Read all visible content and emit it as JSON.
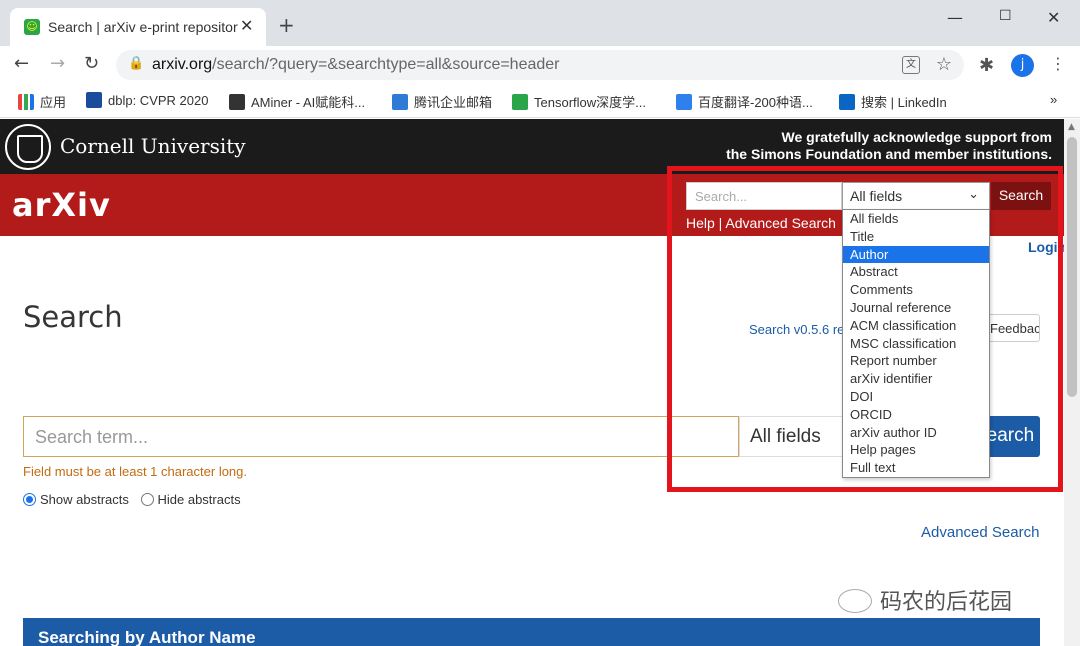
{
  "browser": {
    "tab_title": "Search | arXiv e-print repository",
    "tab_close": "✕",
    "new_tab": "+",
    "url_host": "arxiv.org",
    "url_rest": "/search/?query=&searchtype=all&source=header",
    "profile_initial": "j",
    "bookmarks": [
      {
        "label": "应用",
        "icon_color": "#e8453c"
      },
      {
        "label": "dblp: CVPR 2020",
        "icon_color": "#1b4c9c"
      },
      {
        "label": "AMiner - AI赋能科...",
        "icon_color": "#333333"
      },
      {
        "label": "腾讯企业邮箱",
        "icon_color": "#2d7bd6"
      },
      {
        "label": "Tensorflow深度学...",
        "icon_color": "#2aa54a"
      },
      {
        "label": "百度翻译-200种语...",
        "icon_color": "#2f80ed"
      },
      {
        "label": "搜索 | LinkedIn",
        "icon_color": "#0a66c2"
      }
    ],
    "bookmarks_more": "»"
  },
  "header": {
    "institution": "Cornell University",
    "support_line1": "We gratefully acknowledge support from",
    "support_line2": "the Simons Foundation and member institutions.",
    "logo": "arXiv",
    "search_placeholder": "Search...",
    "field_selected": "All fields",
    "search_button": "Search",
    "help_links": "Help | Advanced Search",
    "brand_color": "#b31b1b"
  },
  "dropdown": {
    "options": [
      "All fields",
      "Title",
      "Author",
      "Abstract",
      "Comments",
      "Journal reference",
      "ACM classification",
      "MSC classification",
      "Report number",
      "arXiv identifier",
      "DOI",
      "ORCID",
      "arXiv author ID",
      "Help pages",
      "Full text"
    ],
    "highlighted": "Author"
  },
  "main": {
    "login": "Login",
    "title": "Search",
    "version_link": "Search v0.5.6 re",
    "feedback": "Feedback?",
    "search_placeholder": "Search term...",
    "field_selected": "All fields",
    "search_button": "Search",
    "error": "Field must be at least 1 character long.",
    "show_abstracts": "Show abstracts",
    "hide_abstracts": "Hide abstracts",
    "advanced_search": "Advanced Search",
    "author_box_title": "Searching by Author Name",
    "watermark": "码农的后花园"
  }
}
